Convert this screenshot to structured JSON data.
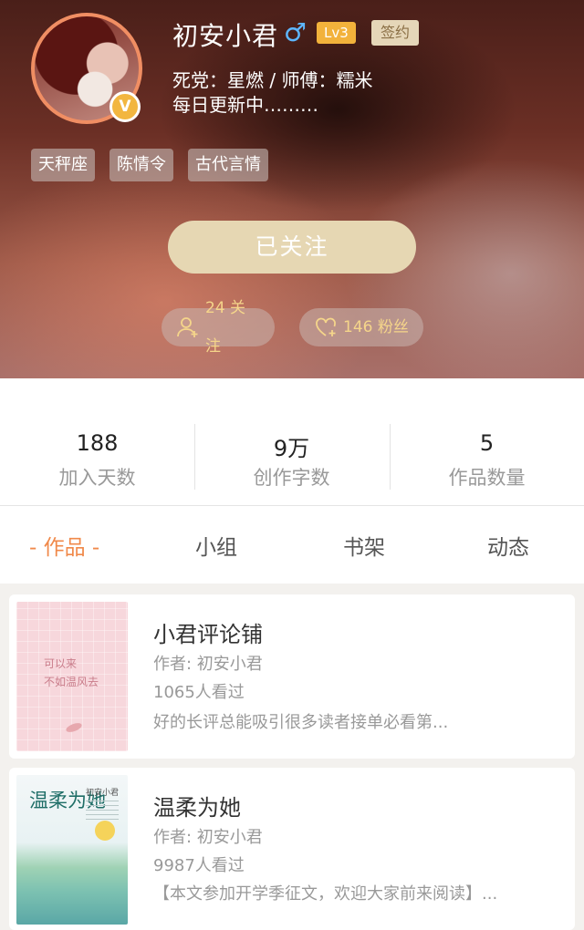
{
  "profile": {
    "name": "初安小君",
    "gender_symbol": "♂",
    "level": "Lv3",
    "sign_badge": "签约",
    "verified_badge": "V",
    "bio_line1": "死党：星燃 / 师傅：糯米",
    "bio_line2": "每日更新中………",
    "tags": [
      "天秤座",
      "陈情令",
      "古代言情"
    ],
    "follow_button": "已关注",
    "following": "24 关注",
    "fans": "146 粉丝"
  },
  "stats": [
    {
      "value": "188",
      "label": "加入天数"
    },
    {
      "value": "9万",
      "label": "创作字数"
    },
    {
      "value": "5",
      "label": "作品数量"
    }
  ],
  "tabs": [
    {
      "label": "- 作品 -",
      "active": true
    },
    {
      "label": "小组",
      "active": false
    },
    {
      "label": "书架",
      "active": false
    },
    {
      "label": "动态",
      "active": false
    }
  ],
  "works": [
    {
      "title": "小君评论铺",
      "author": "作者: 初安小君",
      "views": "1065人看过",
      "desc": "好的长评总能吸引很多读者接单必看第...",
      "cover_text_1": "可以来",
      "cover_text_2": "不如温风去"
    },
    {
      "title": "温柔为她",
      "author": "作者: 初安小君",
      "views": "9987人看过",
      "desc": "【本文参加开学季征文，欢迎大家前来阅读】...",
      "cover_text_1": "温柔为她",
      "cover_text_2": "初安小君"
    }
  ],
  "colors": {
    "accent": "#f0894a",
    "level_badge": "#f2b23b",
    "follow_button": "#e6d7b3"
  }
}
